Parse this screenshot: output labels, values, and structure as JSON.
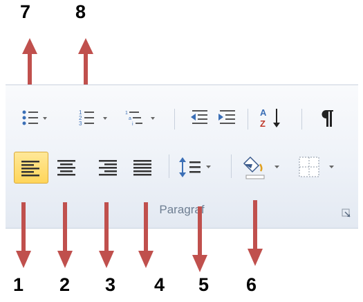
{
  "ribbon": {
    "group_label": "Paragraf",
    "row1": [
      {
        "name": "bullets",
        "icon": "bullet-list-icon"
      },
      {
        "name": "numbering",
        "icon": "numbered-list-icon"
      },
      {
        "name": "multilevel-list",
        "icon": "multilevel-list-icon"
      },
      {
        "name": "decrease-indent",
        "icon": "decrease-indent-icon"
      },
      {
        "name": "increase-indent",
        "icon": "increase-indent-icon"
      },
      {
        "name": "sort",
        "icon": "sort-az-icon"
      },
      {
        "name": "show-hide-marks",
        "icon": "pilcrow-icon"
      }
    ],
    "row2": [
      {
        "name": "align-left",
        "icon": "align-left-icon",
        "active": true
      },
      {
        "name": "center",
        "icon": "align-center-icon"
      },
      {
        "name": "align-right",
        "icon": "align-right-icon"
      },
      {
        "name": "justify",
        "icon": "justify-icon"
      },
      {
        "name": "line-spacing",
        "icon": "line-spacing-icon"
      },
      {
        "name": "shading",
        "icon": "paint-bucket-icon"
      },
      {
        "name": "borders",
        "icon": "borders-icon"
      }
    ],
    "dialog_launcher_icon": "dialog-launcher-icon"
  },
  "annotations": {
    "labels": [
      "1",
      "2",
      "3",
      "4",
      "5",
      "6",
      "7",
      "8"
    ],
    "arrow_color": "#c0504d"
  },
  "colors": {
    "active_button": "#ffd55a",
    "icon_blue": "#3b6fb6",
    "text_gray": "#6e7e92"
  }
}
